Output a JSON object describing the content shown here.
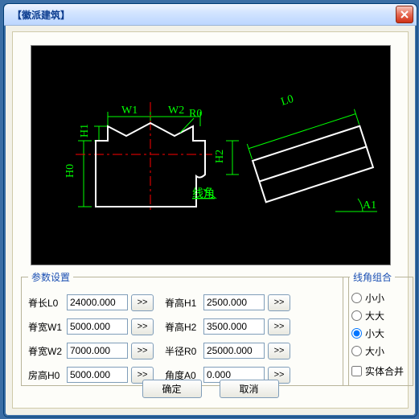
{
  "window": {
    "title": "【徽派建筑】"
  },
  "params_legend": "参数设置",
  "combo_legend": "线角组合",
  "params": [
    [
      {
        "label": "脊长L0",
        "value": "24000.000"
      },
      {
        "label": "脊高H1",
        "value": "2500.000"
      }
    ],
    [
      {
        "label": "脊宽W1",
        "value": "5000.000"
      },
      {
        "label": "脊高H2",
        "value": "3500.000"
      }
    ],
    [
      {
        "label": "脊宽W2",
        "value": "7000.000"
      },
      {
        "label": "半径R0",
        "value": "25000.000"
      }
    ],
    [
      {
        "label": "房高H0",
        "value": "5000.000"
      },
      {
        "label": "角度A0",
        "value": "0.000"
      }
    ]
  ],
  "spin_label": ">>",
  "combo": {
    "options": [
      "小小",
      "大大",
      "小大",
      "大小"
    ],
    "selected": 2,
    "merge_label": "实体合并",
    "merge_checked": false
  },
  "buttons": {
    "ok": "确定",
    "cancel": "取消"
  },
  "cad": {
    "W1": "W1",
    "W2": "W2",
    "H0": "H0",
    "H1": "H1",
    "H2": "H2",
    "R0": "R0",
    "L0": "L0",
    "A1": "A1",
    "linejiao": "线角"
  }
}
